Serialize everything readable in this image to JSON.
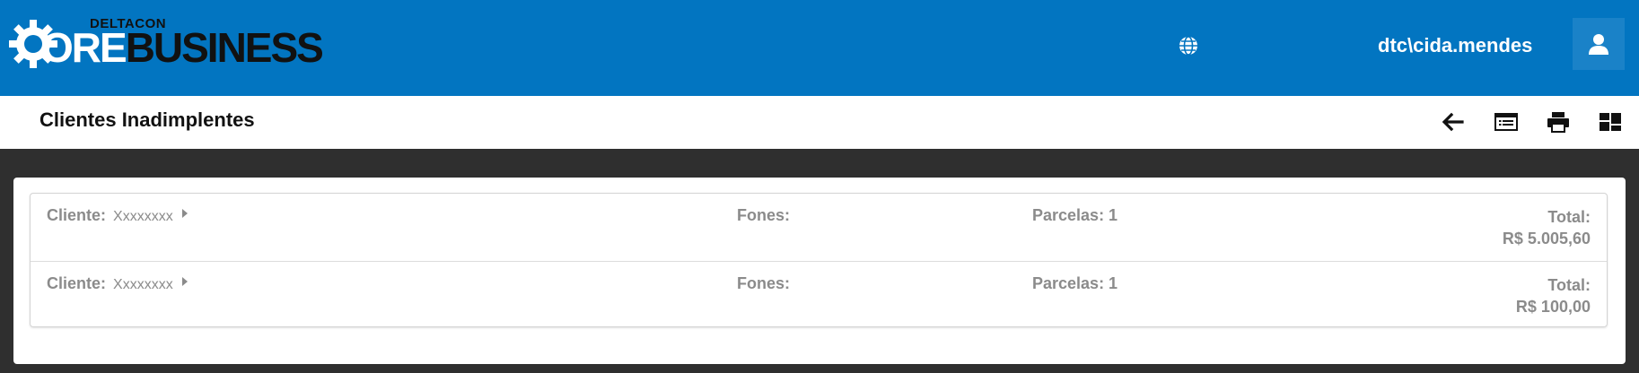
{
  "header": {
    "logo_top": "DELTACON",
    "logo_ore": "ORE",
    "logo_business": "BUSINESS",
    "username": "dtc\\cida.mendes",
    "globe_icon": "globe-icon",
    "user_icon": "user-icon",
    "brand_color": "#0275c1"
  },
  "subheader": {
    "title": "Clientes Inadimplentes",
    "tools": [
      "arrow-left-icon",
      "list-icon",
      "printer-icon",
      "dashboard-icon"
    ]
  },
  "list": {
    "rows": [
      {
        "cliente_label": "Cliente:",
        "cliente_name": "Xxxxxxxx",
        "fones_label": "Fones:",
        "parcelas_label": "Parcelas: 1",
        "total_label": "Total:",
        "total_value": "R$ 5.005,60"
      },
      {
        "cliente_label": "Cliente:",
        "cliente_name": "Xxxxxxxx",
        "fones_label": "Fones:",
        "parcelas_label": "Parcelas: 1",
        "total_label": "Total:",
        "total_value": "R$ 100,00"
      }
    ]
  }
}
